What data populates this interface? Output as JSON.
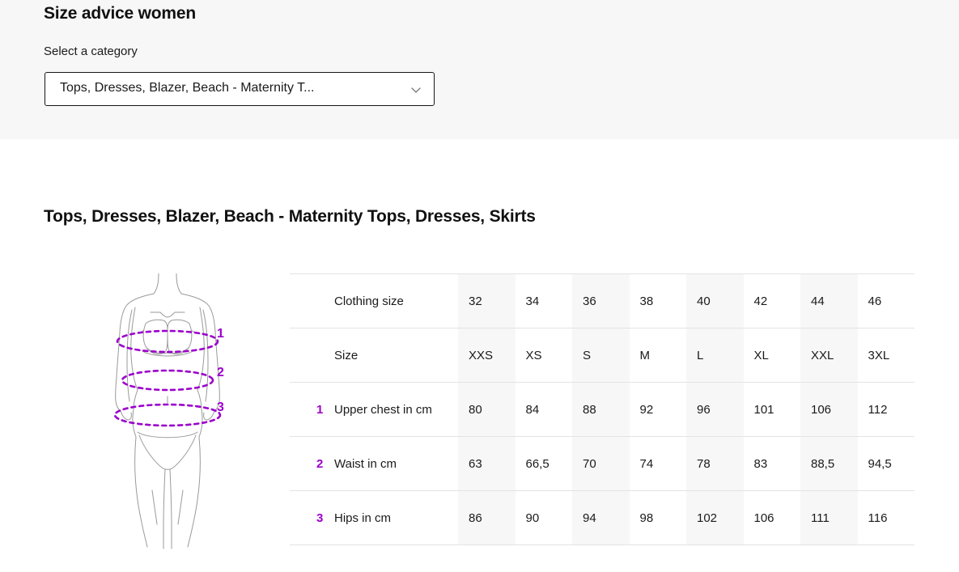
{
  "header": {
    "title": "Size advice women",
    "select_label": "Select a category",
    "selected_category": "Tops, Dresses, Blazer, Beach - Maternity T...",
    "chevron_icon": "chevron-down-icon"
  },
  "main": {
    "section_title": "Tops, Dresses, Blazer, Beach - Maternity Tops, Dresses, Skirts",
    "figure": {
      "icon": "female-body-measurement-diagram",
      "markers": [
        "1",
        "2",
        "3"
      ]
    }
  },
  "colors": {
    "accent_purple": "#9c00cc",
    "band_gray": "#f7f7f7",
    "border_gray": "#e3e3e3",
    "text": "#1a1a1a"
  },
  "table": {
    "rows": [
      {
        "num": "",
        "label": "Clothing size",
        "values": [
          "32",
          "34",
          "36",
          "38",
          "40",
          "42",
          "44",
          "46"
        ]
      },
      {
        "num": "",
        "label": "Size",
        "values": [
          "XXS",
          "XS",
          "S",
          "M",
          "L",
          "XL",
          "XXL",
          "3XL"
        ]
      },
      {
        "num": "1",
        "label": "Upper chest in cm",
        "values": [
          "80",
          "84",
          "88",
          "92",
          "96",
          "101",
          "106",
          "112"
        ]
      },
      {
        "num": "2",
        "label": "Waist in cm",
        "values": [
          "63",
          "66,5",
          "70",
          "74",
          "78",
          "83",
          "88,5",
          "94,5"
        ]
      },
      {
        "num": "3",
        "label": "Hips in cm",
        "values": [
          "86",
          "90",
          "94",
          "98",
          "102",
          "106",
          "111",
          "116"
        ]
      }
    ]
  }
}
